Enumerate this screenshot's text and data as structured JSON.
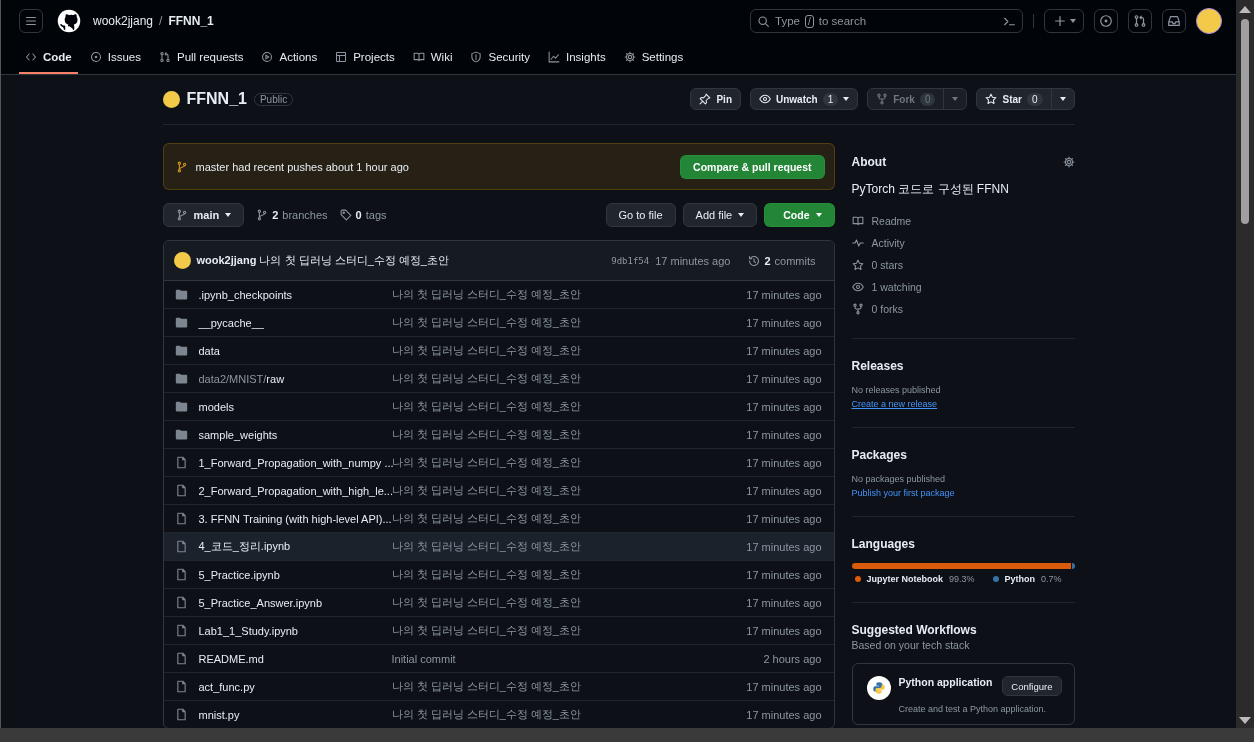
{
  "header": {
    "owner": "wook2jjang",
    "separator": "/",
    "repo": "FFNN_1",
    "search": {
      "placeholder_before": "Type",
      "key": "/",
      "placeholder_after": "to search"
    }
  },
  "tabs": [
    {
      "label": "Code",
      "selected": true
    },
    {
      "label": "Issues",
      "selected": false
    },
    {
      "label": "Pull requests",
      "selected": false
    },
    {
      "label": "Actions",
      "selected": false
    },
    {
      "label": "Projects",
      "selected": false
    },
    {
      "label": "Wiki",
      "selected": false
    },
    {
      "label": "Security",
      "selected": false
    },
    {
      "label": "Insights",
      "selected": false
    },
    {
      "label": "Settings",
      "selected": false
    }
  ],
  "repo": {
    "name": "FFNN_1",
    "visibility": "Public",
    "actions": [
      {
        "label": "Pin",
        "kind": "pin",
        "disabled": false
      },
      {
        "label": "Unwatch",
        "kind": "watch",
        "count": "1",
        "disabled": false
      },
      {
        "label": "Fork",
        "kind": "fork",
        "count": "0",
        "disabled": true
      },
      {
        "label": "Star",
        "kind": "star",
        "count": "0",
        "disabled": false
      }
    ]
  },
  "banner": {
    "branch": "master",
    "text": "had recent pushes about 1 hour ago",
    "button": "Compare & pull request"
  },
  "toolbar": {
    "branch": "main",
    "branches_count": "2",
    "branches_label": "branches",
    "tags_count": "0",
    "tags_label": "tags",
    "go_to_file": "Go to file",
    "add_file": "Add file",
    "code": "Code"
  },
  "commit": {
    "author": "wook2jjang",
    "message": "나의 첫 딥러닝 스터디_수정 예정_초안",
    "hash": "9db1f54",
    "time": "17 minutes ago",
    "commits_count": "2",
    "commits_label": "commits"
  },
  "files": [
    {
      "kind": "folder",
      "name": ".ipynb_checkpoints",
      "message": "나의 첫 딥러닝 스터디_수정 예정_초안",
      "time": "17 minutes ago",
      "selected": false
    },
    {
      "kind": "folder",
      "name": "__pycache__",
      "message": "나의 첫 딥러닝 스터디_수정 예정_초안",
      "time": "17 minutes ago",
      "selected": false
    },
    {
      "kind": "folder",
      "name": "data",
      "message": "나의 첫 딥러닝 스터디_수정 예정_초안",
      "time": "17 minutes ago",
      "selected": false
    },
    {
      "kind": "folder",
      "path": "data2/MNIST/",
      "name": "raw",
      "message": "나의 첫 딥러닝 스터디_수정 예정_초안",
      "time": "17 minutes ago",
      "selected": false
    },
    {
      "kind": "folder",
      "name": "models",
      "message": "나의 첫 딥러닝 스터디_수정 예정_초안",
      "time": "17 minutes ago",
      "selected": false
    },
    {
      "kind": "folder",
      "name": "sample_weights",
      "message": "나의 첫 딥러닝 스터디_수정 예정_초안",
      "time": "17 minutes ago",
      "selected": false
    },
    {
      "kind": "file",
      "name": "1_Forward_Propagation_with_numpy ...",
      "message": "나의 첫 딥러닝 스터디_수정 예정_초안",
      "time": "17 minutes ago",
      "selected": false
    },
    {
      "kind": "file",
      "name": "2_Forward_Propagation_with_high_le...",
      "message": "나의 첫 딥러닝 스터디_수정 예정_초안",
      "time": "17 minutes ago",
      "selected": false
    },
    {
      "kind": "file",
      "name": "3. FFNN Training (with high-level API)...",
      "message": "나의 첫 딥러닝 스터디_수정 예정_초안",
      "time": "17 minutes ago",
      "selected": false
    },
    {
      "kind": "file",
      "name": "4_코드_정리.ipynb",
      "message": "나의 첫 딥러닝 스터디_수정 예정_초안",
      "time": "17 minutes ago",
      "selected": true
    },
    {
      "kind": "file",
      "name": "5_Practice.ipynb",
      "message": "나의 첫 딥러닝 스터디_수정 예정_초안",
      "time": "17 minutes ago",
      "selected": false
    },
    {
      "kind": "file",
      "name": "5_Practice_Answer.ipynb",
      "message": "나의 첫 딥러닝 스터디_수정 예정_초안",
      "time": "17 minutes ago",
      "selected": false
    },
    {
      "kind": "file",
      "name": "Lab1_1_Study.ipynb",
      "message": "나의 첫 딥러닝 스터디_수정 예정_초안",
      "time": "17 minutes ago",
      "selected": false
    },
    {
      "kind": "file",
      "name": "README.md",
      "message": "Initial commit",
      "time": "2 hours ago",
      "selected": false
    },
    {
      "kind": "file",
      "name": "act_func.py",
      "message": "나의 첫 딥러닝 스터디_수정 예정_초안",
      "time": "17 minutes ago",
      "selected": false
    },
    {
      "kind": "file",
      "name": "mnist.py",
      "message": "나의 첫 딥러닝 스터디_수정 예정_초안",
      "time": "17 minutes ago",
      "selected": false
    }
  ],
  "about": {
    "title": "About",
    "description": "PyTorch 코드로 구성된 FFNN",
    "links": [
      {
        "label": "Readme"
      },
      {
        "label": "Activity"
      },
      {
        "count": "0",
        "label": "stars"
      },
      {
        "count": "1",
        "label": "watching"
      },
      {
        "count": "0",
        "label": "forks"
      }
    ]
  },
  "releases": {
    "title": "Releases",
    "note": "No releases published",
    "link": "Create a new release"
  },
  "packages": {
    "title": "Packages",
    "note": "No packages published",
    "link": "Publish your first package"
  },
  "languages": {
    "title": "Languages",
    "items": [
      {
        "name": "Jupyter Notebook",
        "percent": "99.3%",
        "level": 0.993,
        "color": "#da5b0b"
      },
      {
        "name": "Python",
        "percent": "0.7%",
        "level": 0.007,
        "color": "#3572a5"
      }
    ]
  },
  "workflows": {
    "title": "Suggested Workflows",
    "subtitle": "Based on your tech stack",
    "card": {
      "name": "Python application",
      "button": "Configure",
      "description": "Create and test a Python application."
    }
  }
}
